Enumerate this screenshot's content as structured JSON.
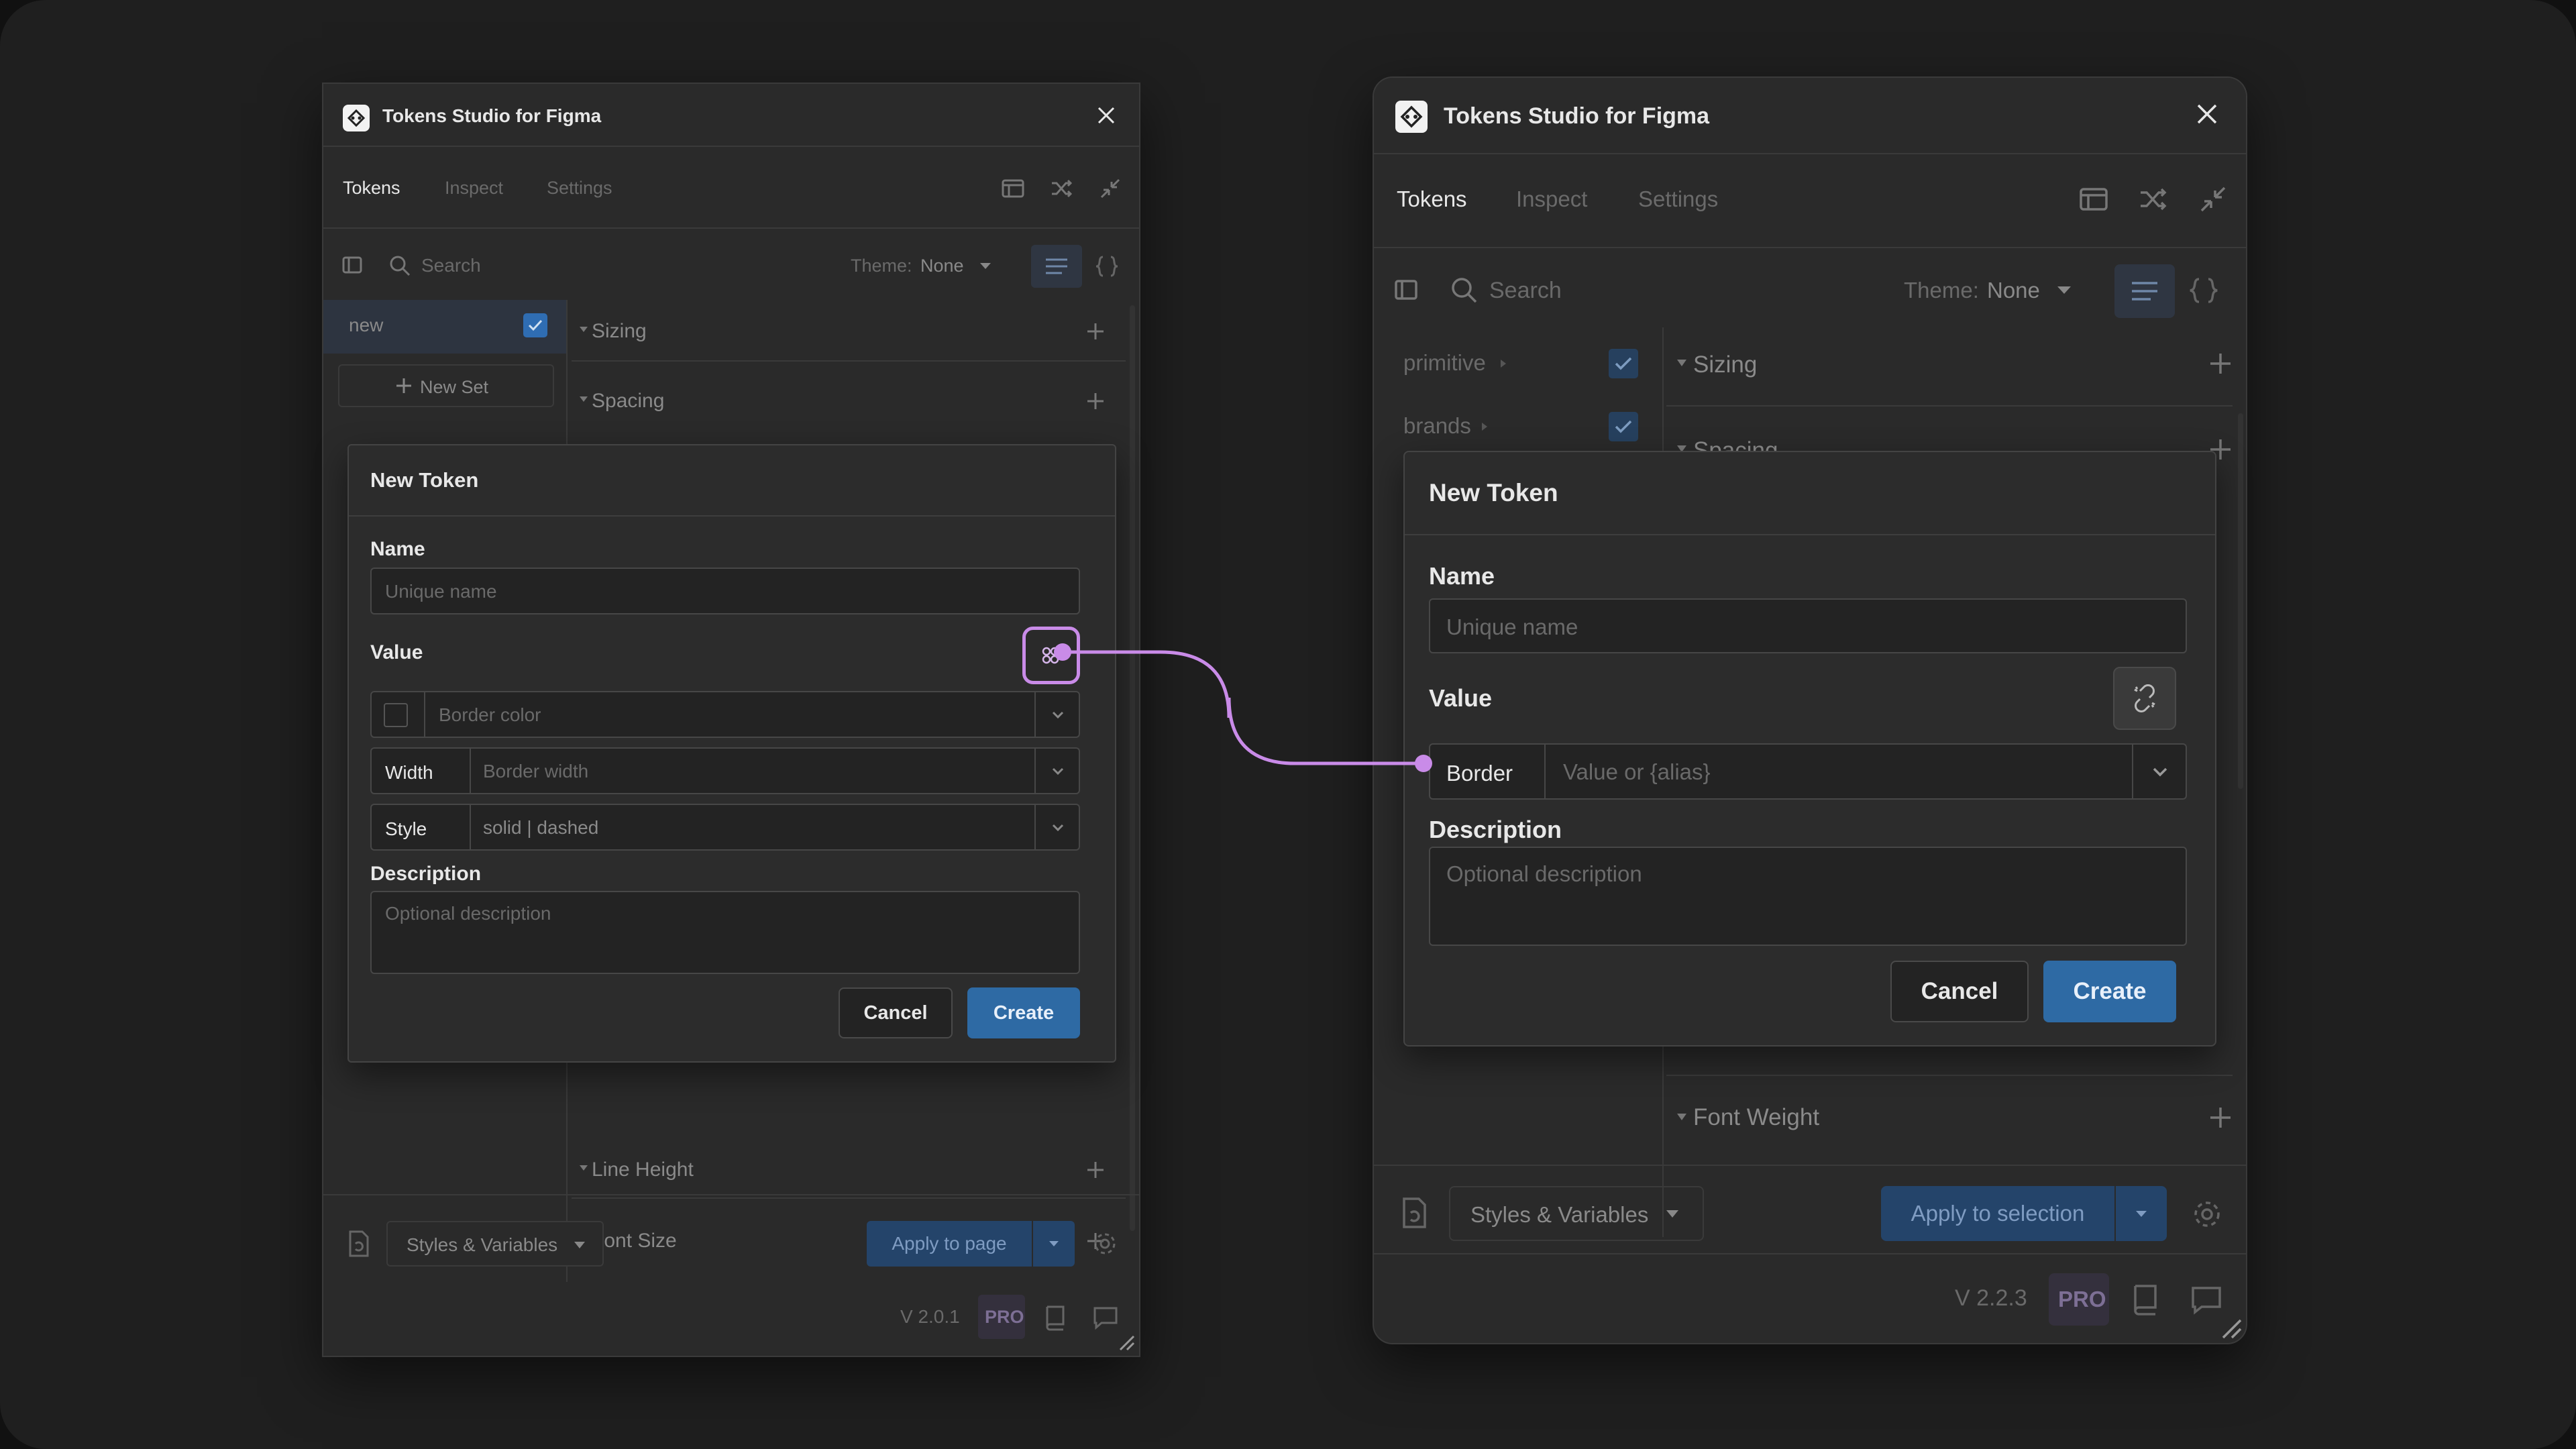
{
  "colors": {
    "accent": "#2e6aa4",
    "highlight": "#c98be8",
    "bg": "#1f1f1f",
    "panel": "#2a2a2a"
  },
  "left": {
    "title": "Tokens Studio for Figma",
    "tabs": [
      "Tokens",
      "Inspect",
      "Settings"
    ],
    "search_placeholder": "Search",
    "theme_label": "Theme:",
    "theme_value": "None",
    "sets": [
      "new"
    ],
    "new_set": "New Set",
    "groups": {
      "sizing": "Sizing",
      "spacing": "Spacing",
      "line_height": "Line Height",
      "font_size": "Font Size"
    },
    "modal": {
      "title": "New Token",
      "name_label": "Name",
      "name_placeholder": "Unique name",
      "value_label": "Value",
      "color_placeholder": "Border color",
      "width_label": "Width",
      "width_placeholder": "Border width",
      "style_label": "Style",
      "style_placeholder": "solid | dashed",
      "description_label": "Description",
      "description_placeholder": "Optional description",
      "cancel": "Cancel",
      "create": "Create"
    },
    "footer": {
      "styles": "Styles & Variables",
      "apply": "Apply to page",
      "version": "V 2.0.1",
      "pro": "PRO"
    }
  },
  "right": {
    "title": "Tokens Studio for Figma",
    "tabs": [
      "Tokens",
      "Inspect",
      "Settings"
    ],
    "search_placeholder": "Search",
    "theme_label": "Theme:",
    "theme_value": "None",
    "sets": [
      "primitive",
      "brands"
    ],
    "groups": {
      "sizing": "Sizing",
      "spacing": "Spacing",
      "font_weight": "Font Weight"
    },
    "modal": {
      "title": "New Token",
      "name_label": "Name",
      "name_placeholder": "Unique name",
      "value_label": "Value",
      "border_label": "Border",
      "value_placeholder": "Value or {alias}",
      "description_label": "Description",
      "description_placeholder": "Optional description",
      "cancel": "Cancel",
      "create": "Create"
    },
    "footer": {
      "styles": "Styles & Variables",
      "apply": "Apply to selection",
      "version": "V 2.2.3",
      "pro": "PRO"
    }
  }
}
